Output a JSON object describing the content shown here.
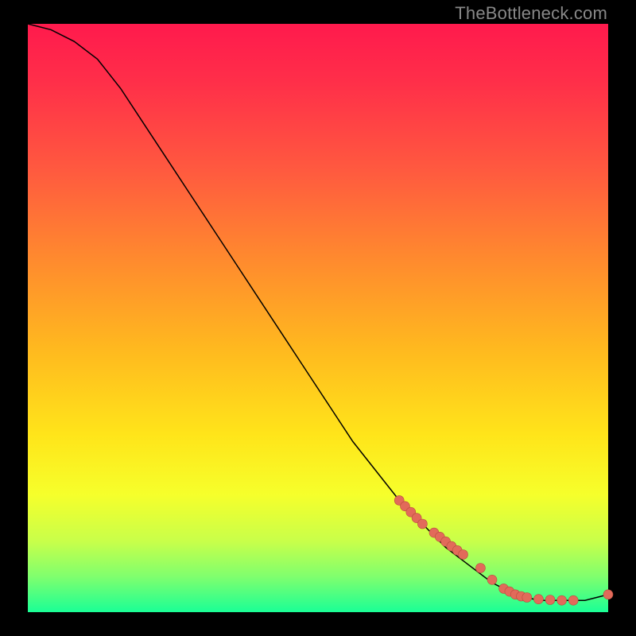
{
  "watermark": "TheBottleneck.com",
  "chart_data": {
    "type": "line",
    "title": "",
    "xlabel": "",
    "ylabel": "",
    "xlim": [
      0,
      100
    ],
    "ylim": [
      0,
      100
    ],
    "series": [
      {
        "name": "curve",
        "x": [
          0,
          4,
          8,
          12,
          16,
          20,
          24,
          28,
          32,
          36,
          40,
          44,
          48,
          52,
          56,
          60,
          64,
          68,
          72,
          76,
          80,
          84,
          88,
          92,
          96,
          100
        ],
        "y": [
          100,
          99,
          97,
          94,
          89,
          83,
          77,
          71,
          65,
          59,
          53,
          47,
          41,
          35,
          29,
          24,
          19,
          15,
          11,
          8,
          5,
          3,
          2,
          2,
          2,
          3
        ]
      }
    ],
    "markers": {
      "name": "highlight-points",
      "color": "#e26a5a",
      "x": [
        64,
        65,
        66,
        67,
        68,
        70,
        71,
        72,
        73,
        74,
        75,
        78,
        80,
        82,
        83,
        84,
        85,
        86,
        88,
        90,
        92,
        94,
        100
      ],
      "y": [
        19,
        18,
        17,
        16,
        15,
        13.5,
        12.8,
        12,
        11.2,
        10.5,
        9.8,
        7.5,
        5.5,
        4,
        3.5,
        3,
        2.7,
        2.5,
        2.2,
        2.1,
        2,
        2,
        3
      ]
    }
  },
  "colors": {
    "gradient_top": "#ff1a4d",
    "gradient_mid1": "#ff8a2e",
    "gradient_mid2": "#ffe51a",
    "gradient_bottom": "#1aff96",
    "curve": "#000000",
    "marker": "#e26a5a"
  }
}
